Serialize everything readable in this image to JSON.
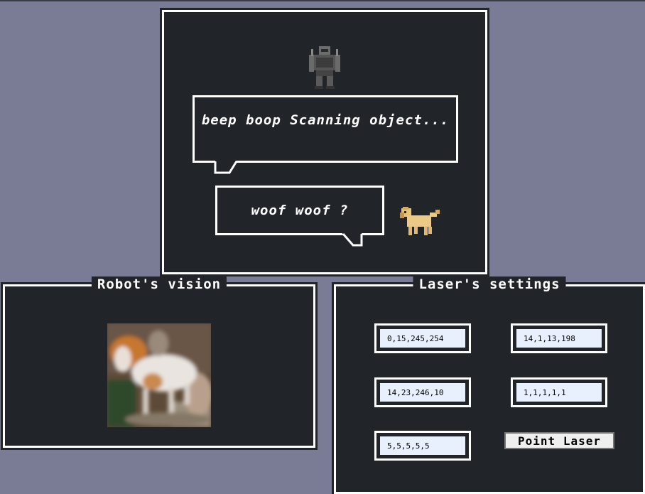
{
  "dialogue": {
    "robot_text": "beep boop Scanning object...",
    "dog_text": "woof woof ?",
    "robot_sprite": "robot-sprite",
    "dog_sprite": "dog-sprite"
  },
  "vision": {
    "title": "Robot's vision",
    "image": "dog-photo"
  },
  "laser": {
    "title": "Laser's settings",
    "fields": [
      {
        "value": "0,15,245,254"
      },
      {
        "value": "14,1,13,198"
      },
      {
        "value": "14,23,246,10"
      },
      {
        "value": "1,1,1,1,1"
      },
      {
        "value": "5,5,5,5,5"
      }
    ],
    "button_label": "Point Laser"
  },
  "colors": {
    "background": "#7a7c96",
    "panel": "#212429",
    "border": "#ffffff",
    "input_bg": "#e8f0fe"
  }
}
